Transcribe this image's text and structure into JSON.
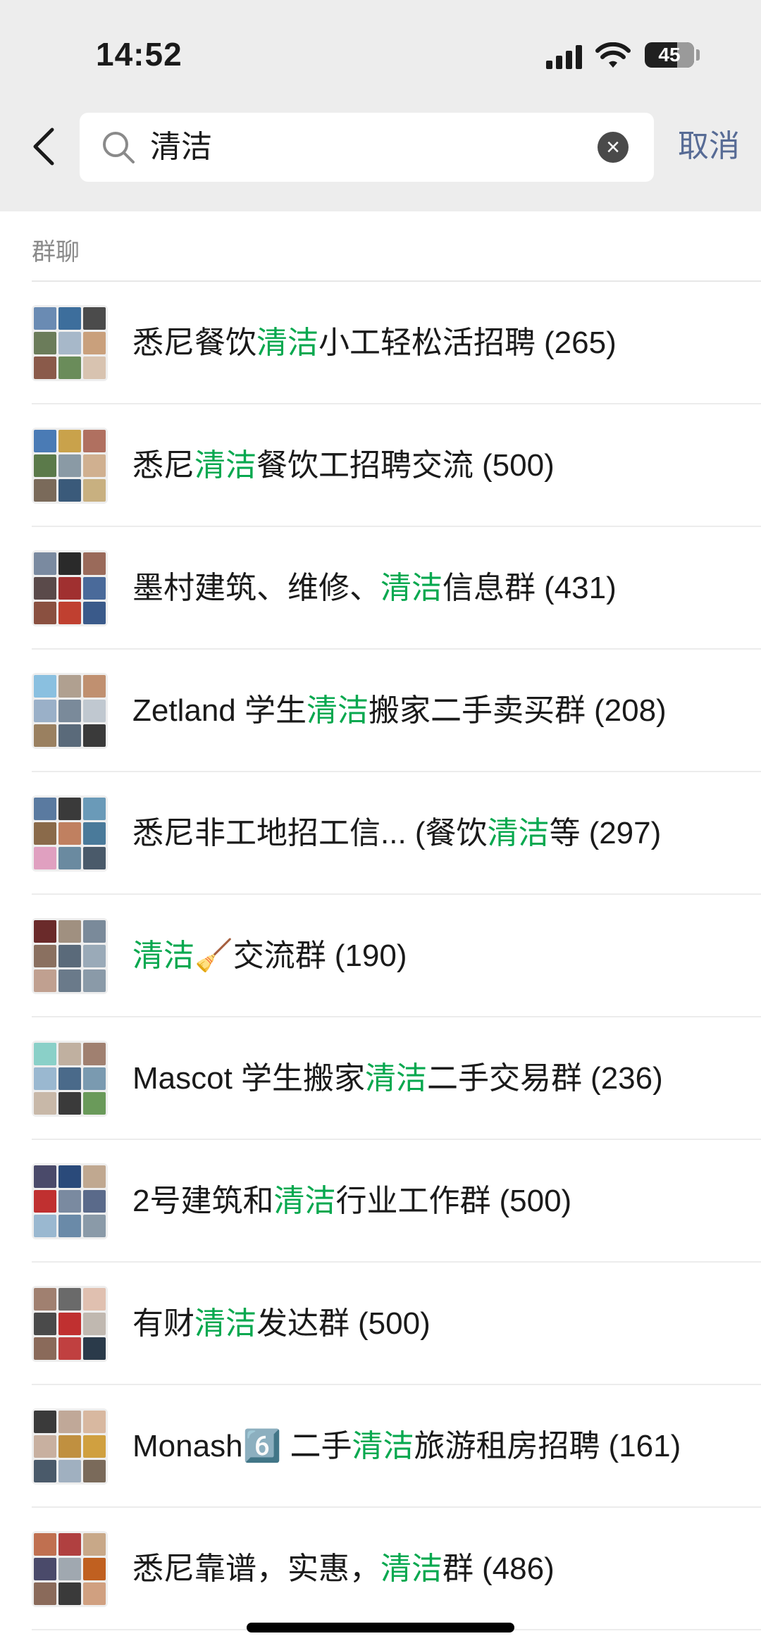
{
  "status_bar": {
    "time": "14:52",
    "battery": "45"
  },
  "search": {
    "value": "清洁",
    "cancel_label": "取消"
  },
  "section": {
    "label": "群聊"
  },
  "groups": [
    {
      "parts": [
        "悉尼餐饮",
        "清洁",
        "小工轻松活招聘"
      ],
      "count": "(265)",
      "avatar": [
        "#6a8bb3",
        "#3d6e9c",
        "#4b4b4b",
        "#6b7c5a",
        "#a7b8c9",
        "#c9a07c",
        "#8a5a4a",
        "#6a8c5a",
        "#d8c3b0"
      ]
    },
    {
      "parts": [
        "悉尼",
        "清洁",
        "餐饮工招聘交流"
      ],
      "count": "(500)",
      "avatar": [
        "#4a7bb5",
        "#c9a24b",
        "#b07060",
        "#5b7a4a",
        "#8a9aa5",
        "#d0b090",
        "#7a6a5a",
        "#3a5a7a",
        "#c8b080"
      ]
    },
    {
      "parts": [
        "墨村建筑、维修、",
        "清洁",
        "信息群"
      ],
      "count": "(431)",
      "avatar": [
        "#7a8aa0",
        "#2a2a2a",
        "#9a6a5a",
        "#5a4a4a",
        "#a03030",
        "#4a6a9a",
        "#8a5040",
        "#c04030",
        "#3a5a8a"
      ]
    },
    {
      "parts": [
        "Zetland 学生",
        "清洁",
        "搬家二手卖买群"
      ],
      "count": "(208)",
      "avatar": [
        "#8ac0e0",
        "#b0a090",
        "#c09070",
        "#9ab0c8",
        "#7a8a9a",
        "#c0c8d0",
        "#9a8060",
        "#5a6a7a",
        "#3a3a3a"
      ]
    },
    {
      "parts": [
        "悉尼非工地招工信... (餐饮",
        "清洁",
        "等"
      ],
      "count": "(297)",
      "avatar": [
        "#5a7aa0",
        "#3a3a3a",
        "#6a9ab8",
        "#8a6a4a",
        "#c08060",
        "#4a7a9a",
        "#e0a0c0",
        "#6a8aa0",
        "#4a5a6a"
      ]
    },
    {
      "parts": [
        "",
        "清洁",
        "🧹交流群"
      ],
      "count": "(190)",
      "avatar": [
        "#6a2a2a",
        "#a09080",
        "#7a8a9a",
        "#8a7060",
        "#5a6a7a",
        "#9aaab8",
        "#c0a090",
        "#6a7a8a",
        "#8a9aa8"
      ]
    },
    {
      "parts": [
        "Mascot 学生搬家",
        "清洁",
        "二手交易群"
      ],
      "count": "(236)",
      "avatar": [
        "#8ad0c8",
        "#c0b0a0",
        "#a08070",
        "#9ab8d0",
        "#4a6a8a",
        "#7a9ab0",
        "#c8b8a8",
        "#3a3a3a",
        "#6a9a5a"
      ]
    },
    {
      "parts": [
        "2号建筑和",
        "清洁",
        "行业工作群"
      ],
      "count": "(500)",
      "avatar": [
        "#4a4a6a",
        "#2a4a7a",
        "#c0a890",
        "#c03030",
        "#7a8aa0",
        "#5a6a8a",
        "#9ab8d0",
        "#6a8aa8",
        "#8a9aa8"
      ]
    },
    {
      "parts": [
        "有财",
        "清洁",
        "发达群"
      ],
      "count": "(500)",
      "avatar": [
        "#a08070",
        "#6a6a6a",
        "#e0c0b0",
        "#4a4a4a",
        "#c03030",
        "#c0b8b0",
        "#8a6a5a",
        "#c04040",
        "#2a3a4a"
      ]
    },
    {
      "parts": [
        "Monash6️⃣ 二手",
        "清洁",
        "旅游租房招聘"
      ],
      "count": "(161)",
      "avatar": [
        "#3a3a3a",
        "#c0a898",
        "#d8b8a0",
        "#c8b0a0",
        "#c09040",
        "#d0a040",
        "#4a5a6a",
        "#a0b0c0",
        "#7a6a5a"
      ]
    },
    {
      "parts": [
        "悉尼靠谱，实惠，",
        "清洁",
        "群"
      ],
      "count": "(486)",
      "avatar": [
        "#c07050",
        "#b04040",
        "#c8a888",
        "#4a4a6a",
        "#a0a8b0",
        "#c06020",
        "#8a6a5a",
        "#3a3a3a",
        "#d0a080"
      ]
    }
  ]
}
